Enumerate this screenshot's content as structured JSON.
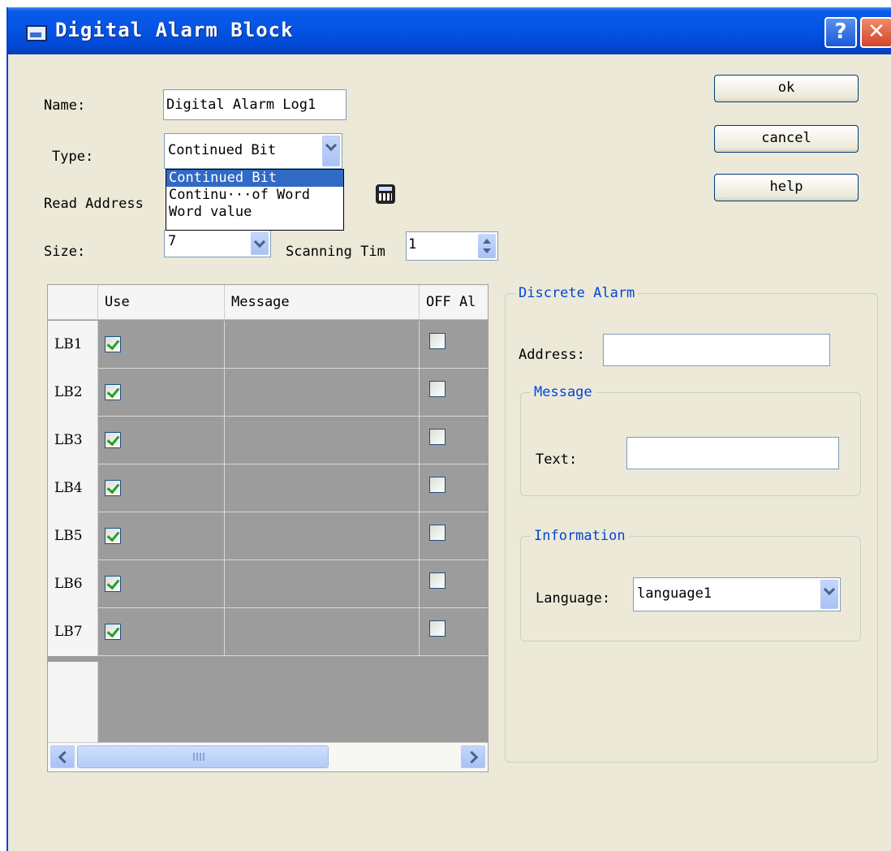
{
  "window": {
    "title": "Digital Alarm Block",
    "help_glyph": "?",
    "close_glyph": "✕"
  },
  "form": {
    "name_label": "Name:",
    "name_value": "Digital Alarm Log1",
    "type_label": "Type:",
    "type_value": "Continued Bit",
    "read_address_label": "Read Address",
    "size_label": "Size:",
    "size_value": "7",
    "scanning_label": "Scanning Tim",
    "scanning_value": "1"
  },
  "type_dropdown": {
    "options": [
      "Continued Bit",
      "Continu···of Word",
      "Word value"
    ],
    "selected_index": 0
  },
  "buttons": {
    "ok": "ok",
    "cancel": "cancel",
    "help": "help"
  },
  "grid": {
    "columns": [
      "Use",
      "Message",
      "OFF Al"
    ],
    "rows": [
      {
        "id": "LB1",
        "use": true,
        "message": "",
        "off_alarm": false
      },
      {
        "id": "LB2",
        "use": true,
        "message": "",
        "off_alarm": false
      },
      {
        "id": "LB3",
        "use": true,
        "message": "",
        "off_alarm": false
      },
      {
        "id": "LB4",
        "use": true,
        "message": "",
        "off_alarm": false
      },
      {
        "id": "LB5",
        "use": true,
        "message": "",
        "off_alarm": false
      },
      {
        "id": "LB6",
        "use": true,
        "message": "",
        "off_alarm": false
      },
      {
        "id": "LB7",
        "use": true,
        "message": "",
        "off_alarm": false
      }
    ],
    "scroll_grip": "|||"
  },
  "discrete_alarm": {
    "title": "Discrete Alarm",
    "address_label": "Address:",
    "address_value": "",
    "message_group": {
      "title": "Message",
      "text_label": "Text:",
      "text_value": ""
    },
    "information_group": {
      "title": "Information",
      "language_label": "Language:",
      "language_value": "language1"
    }
  },
  "colors": {
    "titlebar": "#0654e4",
    "dialog_bg": "#ece9d8",
    "group_title": "#0046d5",
    "selection": "#316ac5",
    "grid_bg": "#9c9c9c"
  }
}
